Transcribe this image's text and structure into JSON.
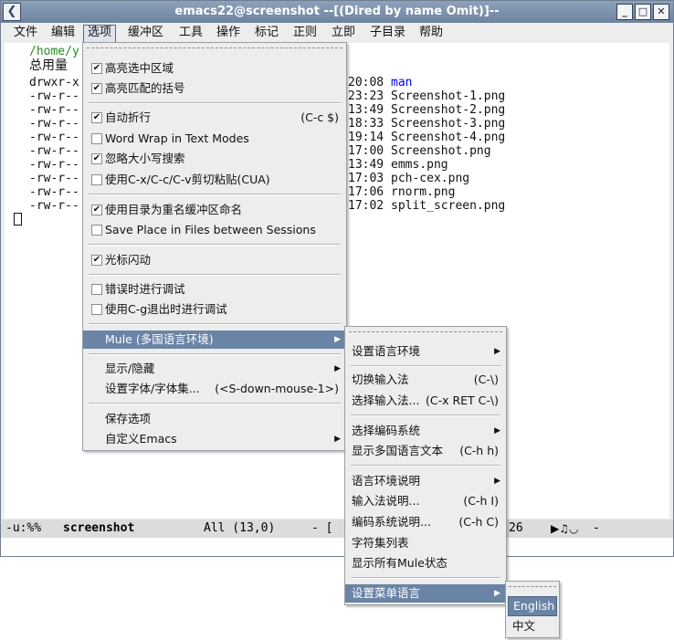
{
  "window": {
    "title": "emacs22@screenshot  --[(Dired by name Omit)]--",
    "icon": "emacs-icon",
    "buttons": [
      "minimize-icon",
      "maximize-icon",
      "close-icon"
    ]
  },
  "menubar": {
    "items": [
      "文件",
      "编辑",
      "选项",
      "缓冲区",
      "工具",
      "操作",
      "标记",
      "正则",
      "立即",
      "子目录",
      "帮助"
    ]
  },
  "editor": {
    "path": "/home/y",
    "total": "总用量",
    "rows": [
      {
        "perm": "drwxr-x",
        "time": "20:08",
        "name": "man"
      },
      {
        "perm": "-rw-r--",
        "time": "23:23",
        "name": "Screenshot-1.png"
      },
      {
        "perm": "-rw-r--",
        "time": "13:49",
        "name": "Screenshot-2.png"
      },
      {
        "perm": "-rw-r--",
        "time": "18:33",
        "name": "Screenshot-3.png"
      },
      {
        "perm": "-rw-r--",
        "time": "19:14",
        "name": "Screenshot-4.png"
      },
      {
        "perm": "-rw-r--",
        "time": "17:00",
        "name": "Screenshot.png"
      },
      {
        "perm": "-rw-r--",
        "time": "13:49",
        "name": "emms.png"
      },
      {
        "perm": "-rw-r--",
        "time": "17:03",
        "name": "pch-cex.png"
      },
      {
        "perm": "-rw-r--",
        "time": "17:06",
        "name": "rnorm.png"
      },
      {
        "perm": "-rw-r--",
        "time": "17:02",
        "name": "split_screen.png"
      }
    ]
  },
  "modeline": {
    "status": "-u:%%",
    "buffer": "screenshot",
    "position": "All (13,0)",
    "mid": "- [",
    "num": "26",
    "tail": "-"
  },
  "options_menu": {
    "items": [
      {
        "label": "高亮选中区域",
        "checked": true
      },
      {
        "label": "高亮匹配的括号",
        "checked": true
      },
      {
        "label": "自动折行",
        "checked": true,
        "shortcut": "(C-c $)"
      },
      {
        "label": "Word Wrap in Text Modes",
        "checked": false
      },
      {
        "label": "忽略大小写搜索",
        "checked": true
      },
      {
        "label": "使用C-x/C-c/C-v剪切粘贴(CUA)",
        "checked": false
      },
      {
        "label": "使用目录为重名缓冲区命名",
        "checked": true
      },
      {
        "label": "Save Place in Files between Sessions",
        "checked": false
      },
      {
        "label": "光标闪动",
        "checked": true
      },
      {
        "label": "错误时进行调试",
        "checked": false
      },
      {
        "label": "使用C-g退出时进行调试",
        "checked": false
      },
      {
        "label": "Mule (多国语言环境)"
      },
      {
        "label": "显示/隐藏"
      },
      {
        "label": "设置字体/字体集...",
        "shortcut": "(<S-down-mouse-1>)"
      },
      {
        "label": "保存选项"
      },
      {
        "label": "自定义Emacs"
      }
    ]
  },
  "mule_menu": {
    "items": [
      {
        "label": "设置语言环境"
      },
      {
        "label": "切换输入法",
        "shortcut": "(C-\\)"
      },
      {
        "label": "选择输入法...",
        "shortcut": "(C-x RET C-\\)"
      },
      {
        "label": "选择编码系统"
      },
      {
        "label": "显示多国语言文本",
        "shortcut": "(C-h h)"
      },
      {
        "label": "语言环境说明"
      },
      {
        "label": "输入法说明...",
        "shortcut": "(C-h I)"
      },
      {
        "label": "编码系统说明...",
        "shortcut": "(C-h C)"
      },
      {
        "label": "字符集列表"
      },
      {
        "label": "显示所有Mule状态"
      },
      {
        "label": "设置菜单语言"
      }
    ]
  },
  "lang_menu": {
    "items": [
      {
        "label": "English"
      },
      {
        "label": "中文"
      }
    ]
  },
  "glyphs": {
    "check": "✔",
    "arrow": "▶"
  },
  "colors": {
    "highlight": "#6a84a6",
    "dir": "#0000ee",
    "path": "#228b22"
  }
}
